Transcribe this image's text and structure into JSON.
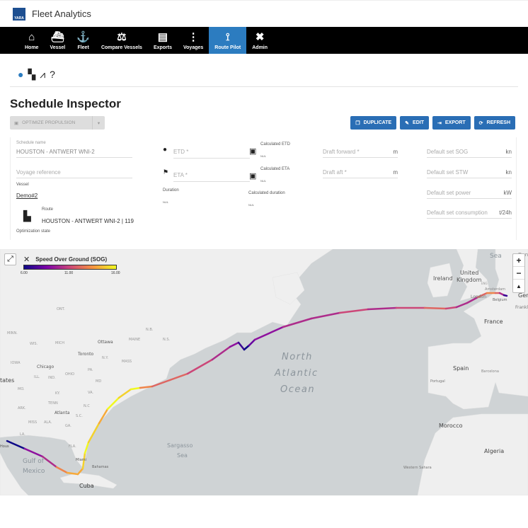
{
  "app": {
    "title": "Fleet Analytics",
    "logo_text": "YARA"
  },
  "nav": [
    {
      "label": "Home",
      "icon": "home-icon",
      "glyph": "⌂"
    },
    {
      "label": "Vessel",
      "icon": "ship-icon",
      "glyph": "⛴"
    },
    {
      "label": "Fleet",
      "icon": "anchor-icon",
      "glyph": "⚓"
    },
    {
      "label": "Compare Vessels",
      "icon": "scale-icon",
      "glyph": "⚖"
    },
    {
      "label": "Exports",
      "icon": "file-chart-icon",
      "glyph": "▤"
    },
    {
      "label": "Voyages",
      "icon": "route-line-icon",
      "glyph": "⋮"
    },
    {
      "label": "Route Pilot",
      "icon": "route-icon",
      "glyph": "⟟",
      "active": true
    },
    {
      "label": "Admin",
      "icon": "tools-icon",
      "glyph": "✖"
    }
  ],
  "subnav": {
    "help": "?"
  },
  "page": {
    "title": "Schedule Inspector"
  },
  "toolbar": {
    "optimize": "OPTIMIZE PROPULSION",
    "duplicate": "DUPLICATE",
    "edit": "EDIT",
    "export": "EXPORT",
    "refresh": "REFRESH"
  },
  "form": {
    "schedule_name_label": "Schedule name",
    "schedule_name": "HOUSTON - ANTWERT WNI-2",
    "voyage_ref_placeholder": "Voyage reference",
    "vessel_label": "Vessel",
    "vessel": "Demo#2",
    "route_label": "Route",
    "route": "HOUSTON - ANTWERT WNI-2 | 119",
    "opt_state_label": "Optimization state",
    "etd_placeholder": "ETD *",
    "eta_placeholder": "ETA *",
    "duration_label": "Duration",
    "duration": "NUL",
    "calc_etd_label": "Calculated ETD",
    "calc_etd": "NUL",
    "calc_eta_label": "Calculated ETA",
    "calc_eta": "NUL",
    "calc_duration_label": "Calculated duration",
    "calc_duration": "NUL",
    "draft_fwd_placeholder": "Draft forward *",
    "draft_fwd_unit": "m",
    "draft_aft_placeholder": "Draft aft *",
    "draft_aft_unit": "m",
    "sog_placeholder": "Default set SOG",
    "sog_unit": "kn",
    "stw_placeholder": "Default set STW",
    "stw_unit": "kn",
    "power_placeholder": "Default set power",
    "power_unit": "kW",
    "consumption_placeholder": "Default set consumption",
    "consumption_unit": "t/24h"
  },
  "map": {
    "legend": {
      "title": "Speed Over Ground (SOG)",
      "min": "6.00",
      "mid": "11.00",
      "max": "16.00"
    },
    "zoom_in": "+",
    "zoom_out": "−",
    "reset": "▲",
    "ocean_labels": [
      "North",
      "Atlantic",
      "Ocean"
    ],
    "labels": {
      "sargasso1": "Sargasso",
      "sargasso2": "Sea",
      "gulf1": "Gulf of",
      "gulf2": "Mexico",
      "sea": "Sea",
      "cuba": "Cuba",
      "bahamas": "Bahamas",
      "miami": "Miami",
      "atlanta": "Atlanta",
      "chicago": "Chicago",
      "toronto": "Toronto",
      "ottawa": "Ottawa",
      "states": "tates",
      "houston": "Hous",
      "ireland": "Ireland",
      "uk1": "United",
      "uk2": "Kingdom",
      "london": "London",
      "amsterdam": "Amsterdam",
      "belgium": "Belgium",
      "france": "France",
      "spain": "Spain",
      "portugal": "Portugal",
      "barcelona": "Barcelona",
      "morocco": "Morocco",
      "algeria": "Algeria",
      "western_sahara": "Western Sahara",
      "frankfurt": "Frankl",
      "germany": "Ger",
      "denmark": "Den",
      "eng": "ENG",
      "nb": "N.B.",
      "ns": "N.S.",
      "maine": "MAINE",
      "mass": "MASS",
      "ny": "N.Y.",
      "pa": "PA.",
      "ohio": "OHIO",
      "va": "VA.",
      "nc": "N.C",
      "sc": "S.C.",
      "ga": "GA.",
      "fla": "FLA.",
      "tenn": "TENN",
      "ky": "KY.",
      "ind": "IND.",
      "ill": "ILL.",
      "iowa": "IOWA",
      "mich": "MICH",
      "wis": "WIS.",
      "minn": "MINN.",
      "ont": "ONT.",
      "mo": "MO.",
      "ark": "ARK.",
      "miss": "MISS",
      "ala": "ALA.",
      "la": "LA.",
      "md": "MD"
    },
    "sog_colors": [
      "#0d0887",
      "#7e03a8",
      "#cc4778",
      "#f89540",
      "#f0f921"
    ],
    "route_sog": [
      6,
      9,
      10,
      13,
      14,
      14,
      15,
      16,
      15,
      14,
      16,
      15,
      16,
      13,
      12,
      12,
      11,
      10,
      9,
      7,
      6,
      8,
      9,
      10,
      10,
      11,
      10,
      11,
      12,
      11,
      10,
      10,
      12,
      13,
      12,
      10,
      7
    ]
  }
}
